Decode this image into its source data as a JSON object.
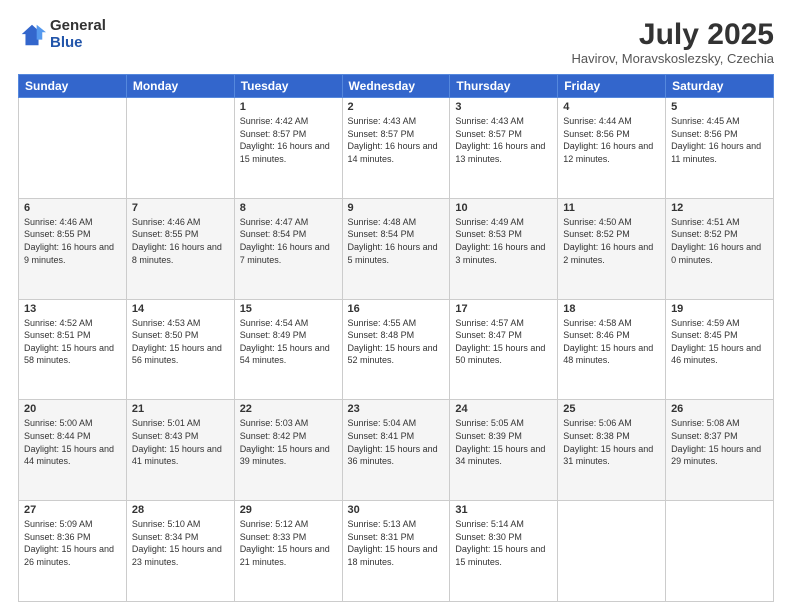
{
  "logo": {
    "general": "General",
    "blue": "Blue"
  },
  "title": {
    "main": "July 2025",
    "sub": "Havirov, Moravskoslezsky, Czechia"
  },
  "days_of_week": [
    "Sunday",
    "Monday",
    "Tuesday",
    "Wednesday",
    "Thursday",
    "Friday",
    "Saturday"
  ],
  "weeks": [
    [
      {
        "day": "",
        "info": ""
      },
      {
        "day": "",
        "info": ""
      },
      {
        "day": "1",
        "info": "Sunrise: 4:42 AM\nSunset: 8:57 PM\nDaylight: 16 hours and 15 minutes."
      },
      {
        "day": "2",
        "info": "Sunrise: 4:43 AM\nSunset: 8:57 PM\nDaylight: 16 hours and 14 minutes."
      },
      {
        "day": "3",
        "info": "Sunrise: 4:43 AM\nSunset: 8:57 PM\nDaylight: 16 hours and 13 minutes."
      },
      {
        "day": "4",
        "info": "Sunrise: 4:44 AM\nSunset: 8:56 PM\nDaylight: 16 hours and 12 minutes."
      },
      {
        "day": "5",
        "info": "Sunrise: 4:45 AM\nSunset: 8:56 PM\nDaylight: 16 hours and 11 minutes."
      }
    ],
    [
      {
        "day": "6",
        "info": "Sunrise: 4:46 AM\nSunset: 8:55 PM\nDaylight: 16 hours and 9 minutes."
      },
      {
        "day": "7",
        "info": "Sunrise: 4:46 AM\nSunset: 8:55 PM\nDaylight: 16 hours and 8 minutes."
      },
      {
        "day": "8",
        "info": "Sunrise: 4:47 AM\nSunset: 8:54 PM\nDaylight: 16 hours and 7 minutes."
      },
      {
        "day": "9",
        "info": "Sunrise: 4:48 AM\nSunset: 8:54 PM\nDaylight: 16 hours and 5 minutes."
      },
      {
        "day": "10",
        "info": "Sunrise: 4:49 AM\nSunset: 8:53 PM\nDaylight: 16 hours and 3 minutes."
      },
      {
        "day": "11",
        "info": "Sunrise: 4:50 AM\nSunset: 8:52 PM\nDaylight: 16 hours and 2 minutes."
      },
      {
        "day": "12",
        "info": "Sunrise: 4:51 AM\nSunset: 8:52 PM\nDaylight: 16 hours and 0 minutes."
      }
    ],
    [
      {
        "day": "13",
        "info": "Sunrise: 4:52 AM\nSunset: 8:51 PM\nDaylight: 15 hours and 58 minutes."
      },
      {
        "day": "14",
        "info": "Sunrise: 4:53 AM\nSunset: 8:50 PM\nDaylight: 15 hours and 56 minutes."
      },
      {
        "day": "15",
        "info": "Sunrise: 4:54 AM\nSunset: 8:49 PM\nDaylight: 15 hours and 54 minutes."
      },
      {
        "day": "16",
        "info": "Sunrise: 4:55 AM\nSunset: 8:48 PM\nDaylight: 15 hours and 52 minutes."
      },
      {
        "day": "17",
        "info": "Sunrise: 4:57 AM\nSunset: 8:47 PM\nDaylight: 15 hours and 50 minutes."
      },
      {
        "day": "18",
        "info": "Sunrise: 4:58 AM\nSunset: 8:46 PM\nDaylight: 15 hours and 48 minutes."
      },
      {
        "day": "19",
        "info": "Sunrise: 4:59 AM\nSunset: 8:45 PM\nDaylight: 15 hours and 46 minutes."
      }
    ],
    [
      {
        "day": "20",
        "info": "Sunrise: 5:00 AM\nSunset: 8:44 PM\nDaylight: 15 hours and 44 minutes."
      },
      {
        "day": "21",
        "info": "Sunrise: 5:01 AM\nSunset: 8:43 PM\nDaylight: 15 hours and 41 minutes."
      },
      {
        "day": "22",
        "info": "Sunrise: 5:03 AM\nSunset: 8:42 PM\nDaylight: 15 hours and 39 minutes."
      },
      {
        "day": "23",
        "info": "Sunrise: 5:04 AM\nSunset: 8:41 PM\nDaylight: 15 hours and 36 minutes."
      },
      {
        "day": "24",
        "info": "Sunrise: 5:05 AM\nSunset: 8:39 PM\nDaylight: 15 hours and 34 minutes."
      },
      {
        "day": "25",
        "info": "Sunrise: 5:06 AM\nSunset: 8:38 PM\nDaylight: 15 hours and 31 minutes."
      },
      {
        "day": "26",
        "info": "Sunrise: 5:08 AM\nSunset: 8:37 PM\nDaylight: 15 hours and 29 minutes."
      }
    ],
    [
      {
        "day": "27",
        "info": "Sunrise: 5:09 AM\nSunset: 8:36 PM\nDaylight: 15 hours and 26 minutes."
      },
      {
        "day": "28",
        "info": "Sunrise: 5:10 AM\nSunset: 8:34 PM\nDaylight: 15 hours and 23 minutes."
      },
      {
        "day": "29",
        "info": "Sunrise: 5:12 AM\nSunset: 8:33 PM\nDaylight: 15 hours and 21 minutes."
      },
      {
        "day": "30",
        "info": "Sunrise: 5:13 AM\nSunset: 8:31 PM\nDaylight: 15 hours and 18 minutes."
      },
      {
        "day": "31",
        "info": "Sunrise: 5:14 AM\nSunset: 8:30 PM\nDaylight: 15 hours and 15 minutes."
      },
      {
        "day": "",
        "info": ""
      },
      {
        "day": "",
        "info": ""
      }
    ]
  ]
}
